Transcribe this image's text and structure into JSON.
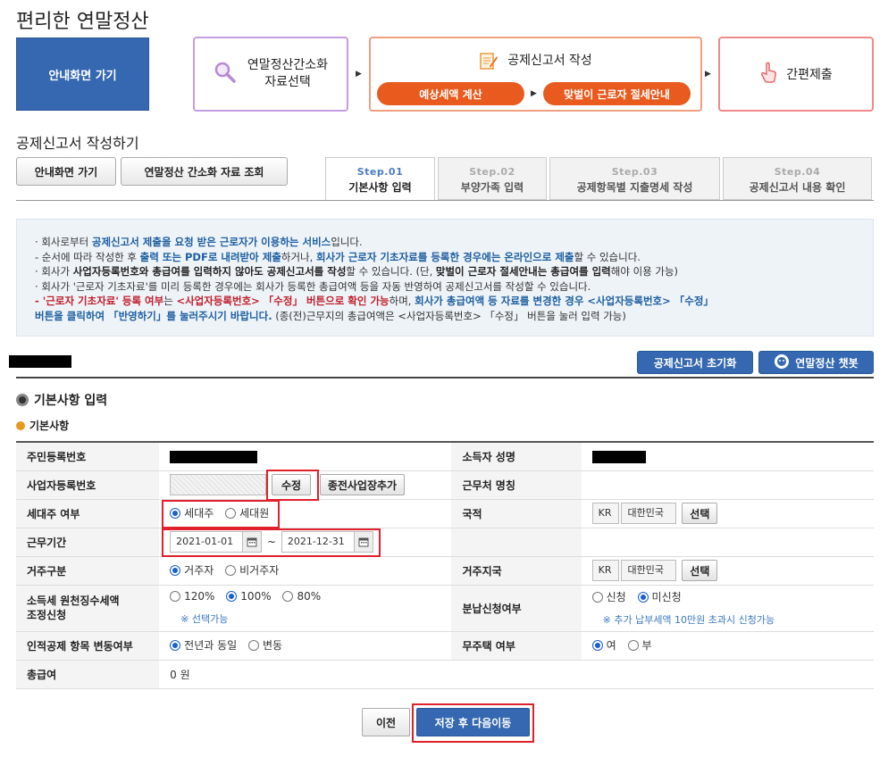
{
  "page": {
    "title": "편리한 연말정산"
  },
  "flow": {
    "guide_button": "안내화면 가기",
    "step1": "연말정산간소화\n자료선택",
    "step2": "공제신고서 작성",
    "step2_pill1": "예상세액 계산",
    "step2_pill2": "맞벌이 근로자 절세안내",
    "step3": "간편제출"
  },
  "section": {
    "title": "공제신고서 작성하기",
    "btn_guide": "안내화면 가기",
    "btn_lookup": "연말정산 간소화 자료 조회"
  },
  "tabs": [
    {
      "step": "Step.01",
      "label": "기본사항 입력"
    },
    {
      "step": "Step.02",
      "label": "부양가족 입력"
    },
    {
      "step": "Step.03",
      "label": "공제항목별 지출명세 작성"
    },
    {
      "step": "Step.04",
      "label": "공제신고서 내용 확인"
    }
  ],
  "notice": {
    "l1a": "회사로부터 ",
    "l1b": "공제신고서 제출을 요청 받은 근로자가 이용하는 서비스",
    "l1c": "입니다.",
    "l2a": " - 순서에 따라 작성한 후 ",
    "l2b": "출력 또는 PDF로 내려받아 제출",
    "l2c": "하거나, ",
    "l2d": "회사가 근로자 기초자료를 등록한 경우에는 온라인으로 제출",
    "l2e": "할 수 있습니다.",
    "l3a": "회사가 ",
    "l3b": "사업자등록번호와 총급여를 입력하지 않아도 공제신고서를 작성",
    "l3c": "할 수 있습니다. (단, ",
    "l3d": "맞벌이 근로자 절세안내는 총급여를 입력",
    "l3e": "해야 이용 가능)",
    "l4": "회사가 '근로자 기초자료'를 미리 등록한 경우에는 회사가 등록한 총급여액 등을 자동 반영하여 공제신고서를 작성할 수 있습니다.",
    "l5a": " - '근로자 기초자료' 등록 여부",
    "l5b": "는 ",
    "l5c": "<사업자등록번호> 「수정」 버튼으로 확인 가능",
    "l5d": "하며, ",
    "l5e": "회사가 총급여액 등 자료를 변경한 경우 <사업자등록번호> 「수정」",
    "l6a": "버튼을 클릭하여 「반영하기」를 눌러주시기 바랍니다.",
    "l6b": " (종(전)근무지의 총급여액은 <사업자등록번호> 「수정」 버튼을 눌러 입력 가능)"
  },
  "actions": {
    "reset": "공제신고서 초기화",
    "chatbot": "연말정산 챗봇"
  },
  "form": {
    "heading": "기본사항 입력",
    "subheading": "기본사항",
    "rrn_label": "주민등록번호",
    "name_label": "소득자 성명",
    "bizno_label": "사업자등록번호",
    "edit_btn": "수정",
    "add_prev_btn": "종전사업장추가",
    "workplace_label": "근무처 명칭",
    "householder_label": "세대주 여부",
    "householder_opt1": "세대주",
    "householder_opt2": "세대원",
    "nationality_label": "국적",
    "nationality_code": "KR",
    "nationality_name": "대한민국",
    "select_btn": "선택",
    "period_label": "근무기간",
    "period_from": "2021-01-01",
    "period_sep": "~",
    "period_to": "2021-12-31",
    "residence_label": "거주구분",
    "residence_opt1": "거주자",
    "residence_opt2": "비거주자",
    "region_label": "거주지국",
    "region_code": "KR",
    "region_name": "대한민국",
    "withhold_label": "소득세 원천징수세액\n조정신청",
    "withhold_opt1": "120%",
    "withhold_opt2": "100%",
    "withhold_opt3": "80%",
    "withhold_note": "※ 선택가능",
    "installment_label": "분납신청여부",
    "installment_opt1": "신청",
    "installment_opt2": "미신청",
    "installment_note": "※ 추가 납부세액 10만원 초과시 신청가능",
    "personal_label": "인적공제 항목 변동여부",
    "personal_opt1": "전년과 동일",
    "personal_opt2": "변동",
    "nohouse_label": "무주택 여부",
    "nohouse_opt1": "여",
    "nohouse_opt2": "부",
    "salary_label": "총급여",
    "salary_value": "0 원"
  },
  "bottom": {
    "prev": "이전",
    "save_next": "저장 후 다음이동"
  }
}
